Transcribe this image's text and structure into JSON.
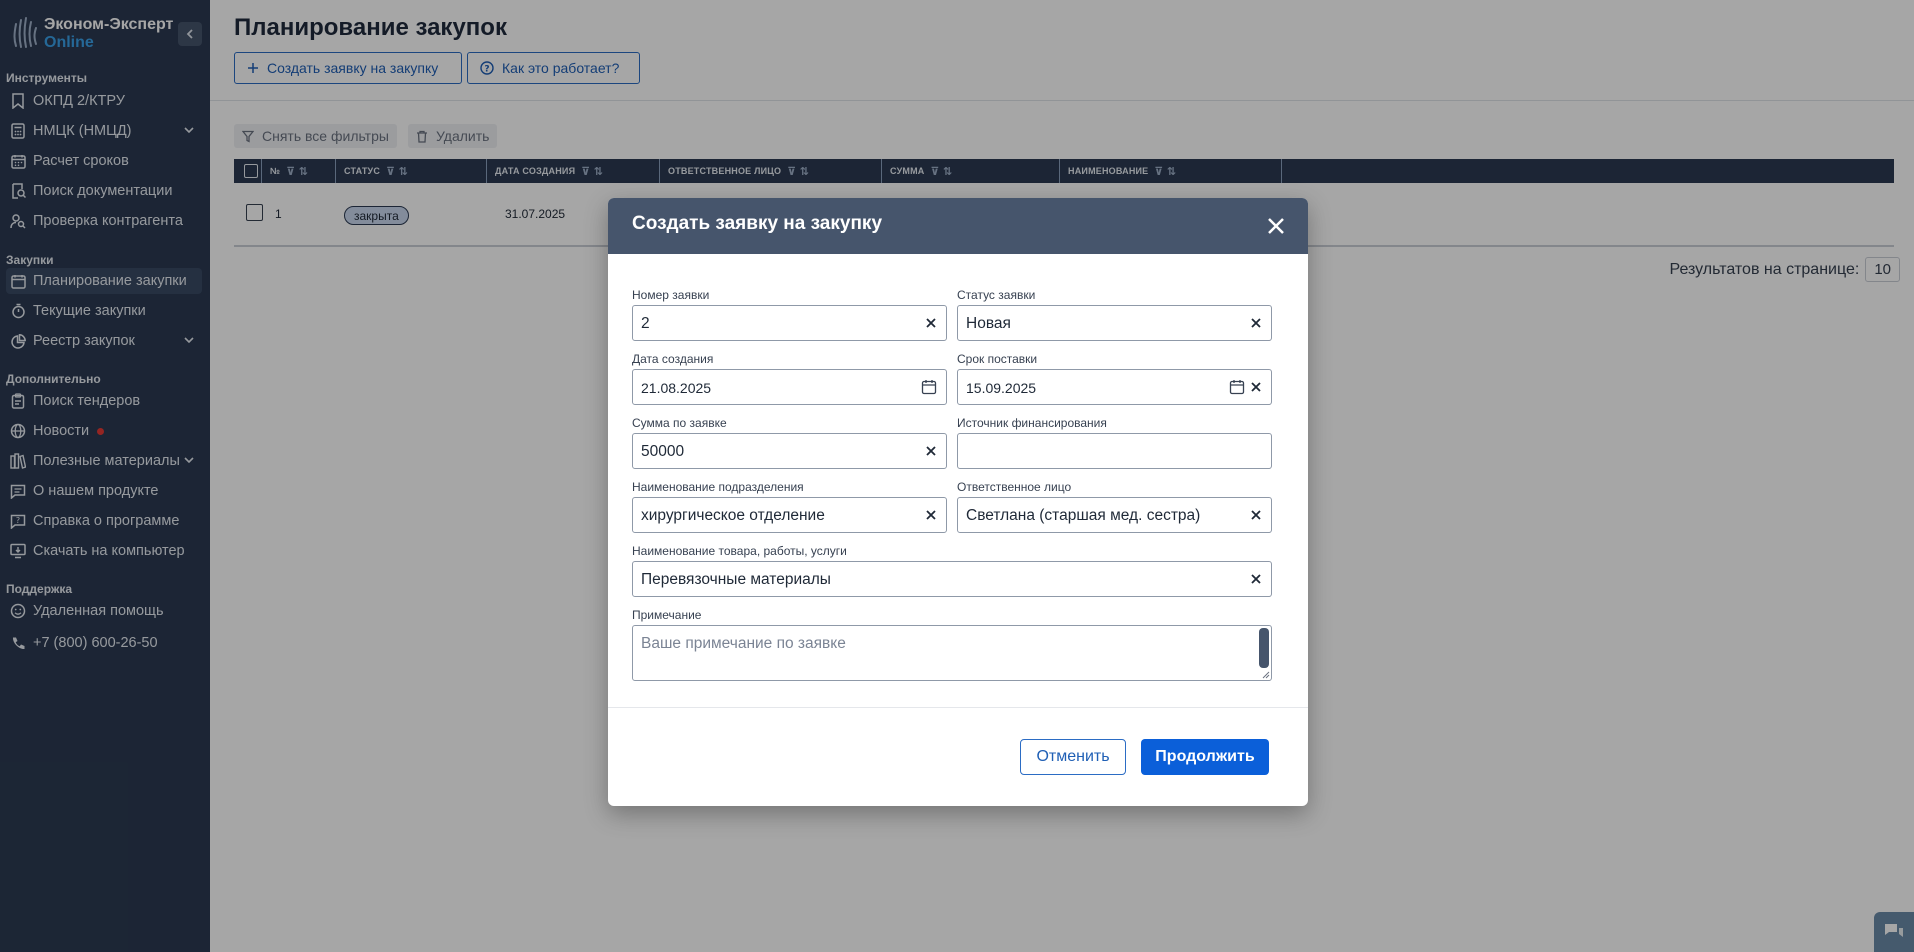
{
  "brand": {
    "name": "Эконом-Эксперт",
    "sub": "Online"
  },
  "sidebar": {
    "sections": [
      {
        "title": "Инструменты",
        "items": [
          "ОКПД 2/КТРУ",
          "НМЦК (НМЦД)",
          "Расчет сроков",
          "Поиск документации",
          "Проверка контрагента"
        ]
      },
      {
        "title": "Закупки",
        "items": [
          "Планирование закупки",
          "Текущие закупки",
          "Реестр закупок"
        ]
      },
      {
        "title": "Дополнительно",
        "items": [
          "Поиск тендеров",
          "Новости",
          "Полезные материалы",
          "О нашем продукте",
          "Справка о программе",
          "Скачать на компьютер"
        ]
      },
      {
        "title": "Поддержка",
        "items": [
          "Удаленная помощь",
          "+7 (800) 600-26-50"
        ]
      }
    ]
  },
  "main": {
    "title": "Планирование закупок",
    "create_button": "Создать заявку на закупку",
    "howto_button": "Как это работает?",
    "clear_filters": "Снять все фильтры",
    "delete": "Удалить",
    "columns": [
      "№",
      "СТАТУС",
      "ДАТА СОЗДАНИЯ",
      "ОТВЕТСТВЕННОЕ ЛИЦО",
      "СУММА",
      "НАИМЕНОВАНИЕ"
    ],
    "rows": [
      {
        "num": "1",
        "status": "закрыта",
        "date": "31.07.2025"
      }
    ],
    "per_page_label": "Результатов на странице:",
    "per_page_value": "10"
  },
  "modal": {
    "title": "Создать заявку на закупку",
    "fields": {
      "number": {
        "label": "Номер заявки",
        "value": "2"
      },
      "status": {
        "label": "Статус заявки",
        "value": "Новая"
      },
      "created": {
        "label": "Дата создания",
        "value": "21.08.2025"
      },
      "delivery": {
        "label": "Срок поставки",
        "value": "15.09.2025"
      },
      "amount": {
        "label": "Сумма по заявке",
        "value": "50000"
      },
      "source": {
        "label": "Источник финансирования",
        "value": ""
      },
      "department": {
        "label": "Наименование подразделения",
        "value": "хирургическое отделение"
      },
      "responsible": {
        "label": "Ответственное лицо",
        "value": "Светлана (старшая мед. сестра)"
      },
      "goods": {
        "label": "Наименование товара, работы, услуги",
        "value": "Перевязочные материалы"
      },
      "note": {
        "label": "Примечание",
        "placeholder": "Ваше примечание по заявке"
      }
    },
    "cancel": "Отменить",
    "continue": "Продолжить"
  },
  "colors": {
    "sidebar": "#2b3a52",
    "modal_header": "#46556c",
    "primary": "#0b5fd9",
    "brand_accent": "#3aa0e8",
    "news_dot": "#e53935"
  }
}
